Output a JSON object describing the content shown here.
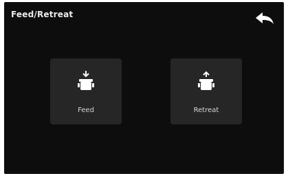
{
  "header": {
    "title": "Feed/Retreat",
    "back_icon": "back-arrow-icon"
  },
  "actions": [
    {
      "label": "Feed",
      "icon": "extruder-feed-icon"
    },
    {
      "label": "Retreat",
      "icon": "extruder-retreat-icon"
    }
  ],
  "colors": {
    "background": "#0d0d0d",
    "tile": "#262626",
    "text": "#ececec",
    "icon": "#ffffff"
  }
}
